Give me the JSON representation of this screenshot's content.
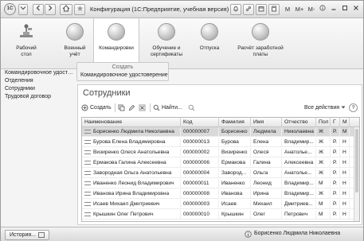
{
  "titlebar": {
    "logo": "1С",
    "title": "Конфигурация  (1С:Предприятие, учебная версия)",
    "m_label": "M",
    "m_plus_label": "M+",
    "m_minus_label": "M-"
  },
  "sections": [
    {
      "label": "Рабочий стол"
    },
    {
      "label": "Военный учёт"
    },
    {
      "label": "Командировки"
    },
    {
      "label": "Обучение и сертификаты"
    },
    {
      "label": "Отпуска"
    },
    {
      "label": "Расчёт заработной платы"
    }
  ],
  "leftnav": {
    "items": [
      {
        "label": "Командировочное удостоверение"
      },
      {
        "label": "Отделения"
      },
      {
        "label": "Сотрудники"
      },
      {
        "label": "Трудовой договор"
      }
    ]
  },
  "actions_panel": {
    "header": "Создать",
    "items": [
      {
        "label": "Командировочное удостоверение"
      }
    ]
  },
  "form": {
    "title": "Сотрудники",
    "toolbar": {
      "create_label": "Создать",
      "find_label": "Найти...",
      "all_actions_label": "Все действия",
      "help_label": "?"
    },
    "columns": [
      "Наименование",
      "Код",
      "Фамилия",
      "Имя",
      "Отчество",
      "Пол",
      "Г",
      "М"
    ],
    "rows": [
      {
        "name": "Борисенко Людмила Николаевна",
        "code": "000000007",
        "last": "Борисенко",
        "first": "Людмила",
        "patronymic": "Николаевна",
        "sex": "Ж",
        "g": "Р.",
        "m": "М"
      },
      {
        "name": "Бурова Елена Владимировна",
        "code": "000000013",
        "last": "Бурова",
        "first": "Елена",
        "patronymic": "Владимир...",
        "sex": "Ж",
        "g": "Р.",
        "m": "Н"
      },
      {
        "name": "Визиренко Олеся Анатольевна",
        "code": "000000002",
        "last": "Визиренко",
        "first": "Олеся",
        "patronymic": "Анатолье...",
        "sex": "Ж",
        "g": "Р.",
        "m": "Н"
      },
      {
        "name": "Ермакова Галина Алексеевна",
        "code": "000000006",
        "last": "Ермакова",
        "first": "Галина",
        "patronymic": "Алексеевна",
        "sex": "Ж",
        "g": "Р.",
        "m": "Н"
      },
      {
        "name": "Завородная Ольга Анатольевна",
        "code": "000000004",
        "last": "Завород...",
        "first": "Ольга",
        "patronymic": "Анатолье...",
        "sex": "Ж",
        "g": "Р.",
        "m": "Н"
      },
      {
        "name": "Иваненко Леонид Владимирович",
        "code": "000000011",
        "last": "Иваненко",
        "first": "Леонид",
        "patronymic": "Владимир...",
        "sex": "М",
        "g": "Р.",
        "m": "Н"
      },
      {
        "name": "Иванова Ирина Владимировна",
        "code": "000000008",
        "last": "Иванова",
        "first": "Ирина",
        "patronymic": "Владимир...",
        "sex": "Ж",
        "g": "Р.",
        "m": "Н"
      },
      {
        "name": "Исаев Михаил Дмитриевич",
        "code": "000000003",
        "last": "Исаев",
        "first": "Михаил",
        "patronymic": "Дмитриев...",
        "sex": "М",
        "g": "Р.",
        "m": "Н"
      },
      {
        "name": "Крышкин Олег Петрович",
        "code": "000000010",
        "last": "Крышкин",
        "first": "Олег",
        "patronymic": "Петрович",
        "sex": "М",
        "g": "Р.",
        "m": "Н"
      }
    ]
  },
  "statusbar": {
    "history_label": "История...",
    "user": "Борисенко Людмила Николаевна"
  }
}
